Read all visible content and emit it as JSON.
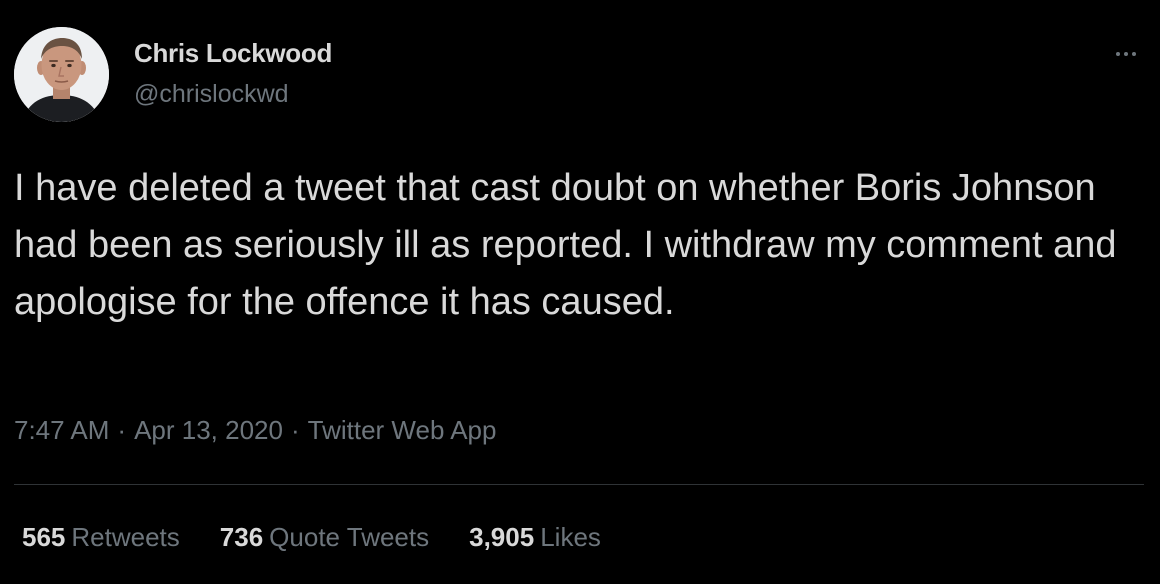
{
  "author": {
    "name": "Chris Lockwood",
    "handle": "@chrislockwd"
  },
  "tweet": {
    "text": "I have deleted a tweet that cast doubt on whether Boris Johnson had been as seriously ill as reported. I withdraw my comment and apologise for the offence it has caused.",
    "time": "7:47 AM",
    "separator": "·",
    "date": "Apr 13, 2020",
    "source": "Twitter Web App"
  },
  "stats": {
    "retweets_count": "565",
    "retweets_label": "Retweets",
    "quote_count": "736",
    "quote_label": "Quote Tweets",
    "likes_count": "3,905",
    "likes_label": "Likes"
  },
  "icons": {
    "more": "more-horizontal-icon",
    "avatar": "avatar"
  },
  "colors": {
    "background": "#000000",
    "primary_text": "#d9d9d9",
    "secondary_text": "#6e767d",
    "divider": "#2f3336"
  }
}
